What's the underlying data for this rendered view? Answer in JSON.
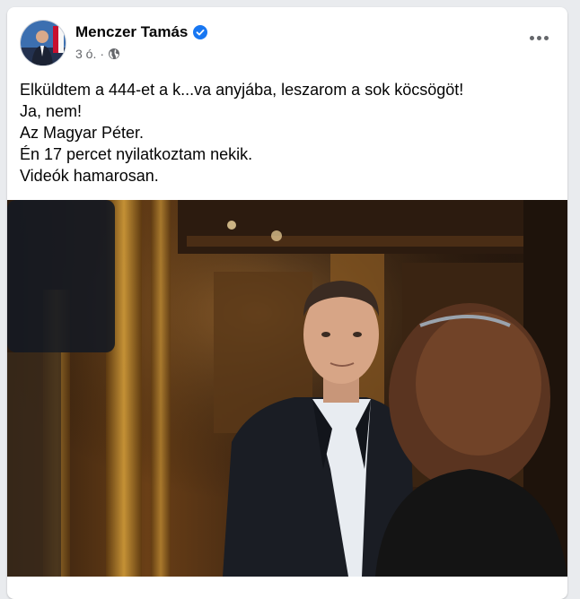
{
  "post": {
    "author": "Menczer Tamás",
    "verified_icon": "verified-badge-icon",
    "time": "3 ó.",
    "separator": "·",
    "audience_icon": "globe-icon",
    "more_icon": "more-options-icon",
    "lines": [
      "Elküldtem a 444-et a k...va anyjába, leszarom a sok köcsögöt!",
      "Ja, nem!",
      "Az Magyar Péter.",
      "Én 17 percet nyilatkoztam nekik.",
      "Videók hamarosan."
    ]
  },
  "colors": {
    "verified": "#1877f2",
    "secondary_text": "#65676b",
    "primary_text": "#050505"
  }
}
